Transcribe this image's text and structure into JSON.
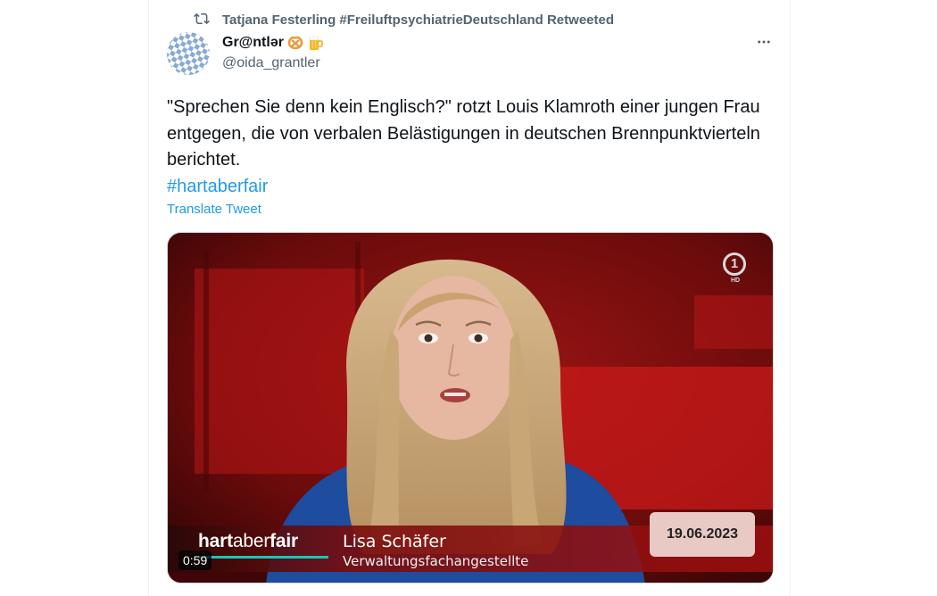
{
  "retweet": {
    "icon": "retweet-icon",
    "text": "Tatjana Festerling #FreiluftpsychiatrieDeutschland Retweeted"
  },
  "author": {
    "display_name": "Gr@ntlər",
    "emojis": [
      "pretzel-emoji",
      "beer-mug-emoji"
    ],
    "handle": "@oida_grantler"
  },
  "more_icon": "ellipsis-icon",
  "tweet": {
    "text": "\"Sprechen Sie denn kein Englisch?\" rotzt Louis Klamroth einer jungen Frau entgegen, die von verbalen Belästigungen in deutschen Brennpunktvierteln berichtet.",
    "hashtag": "#hartaberfair",
    "translate": "Translate Tweet"
  },
  "media": {
    "type": "video",
    "duration": "0:59",
    "overlay": {
      "broadcaster_logo": "1",
      "broadcaster_hd": "HD",
      "show_bold": "hart",
      "show_light": "aber",
      "show_bold2": "fair",
      "person_name": "Lisa Schäfer",
      "person_title": "Verwaltungsfachangestellte",
      "date": "19.06.2023"
    }
  },
  "colors": {
    "accent": "#1d9bf0",
    "secondary_text": "#536471",
    "studio_red": "#8b1010"
  }
}
